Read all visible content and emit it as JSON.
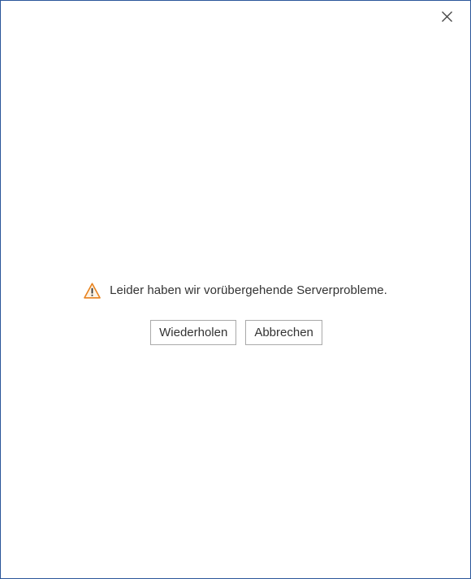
{
  "dialog": {
    "close_icon": "close-icon",
    "message": {
      "icon": "warning-icon",
      "icon_color": "#e8821e",
      "text": "Leider haben wir vorübergehende Serverprobleme."
    },
    "buttons": {
      "retry_label": "Wiederholen",
      "cancel_label": "Abbrechen"
    }
  },
  "colors": {
    "border": "#2b579a",
    "text": "#333333",
    "button_border": "#a9a9a9"
  }
}
